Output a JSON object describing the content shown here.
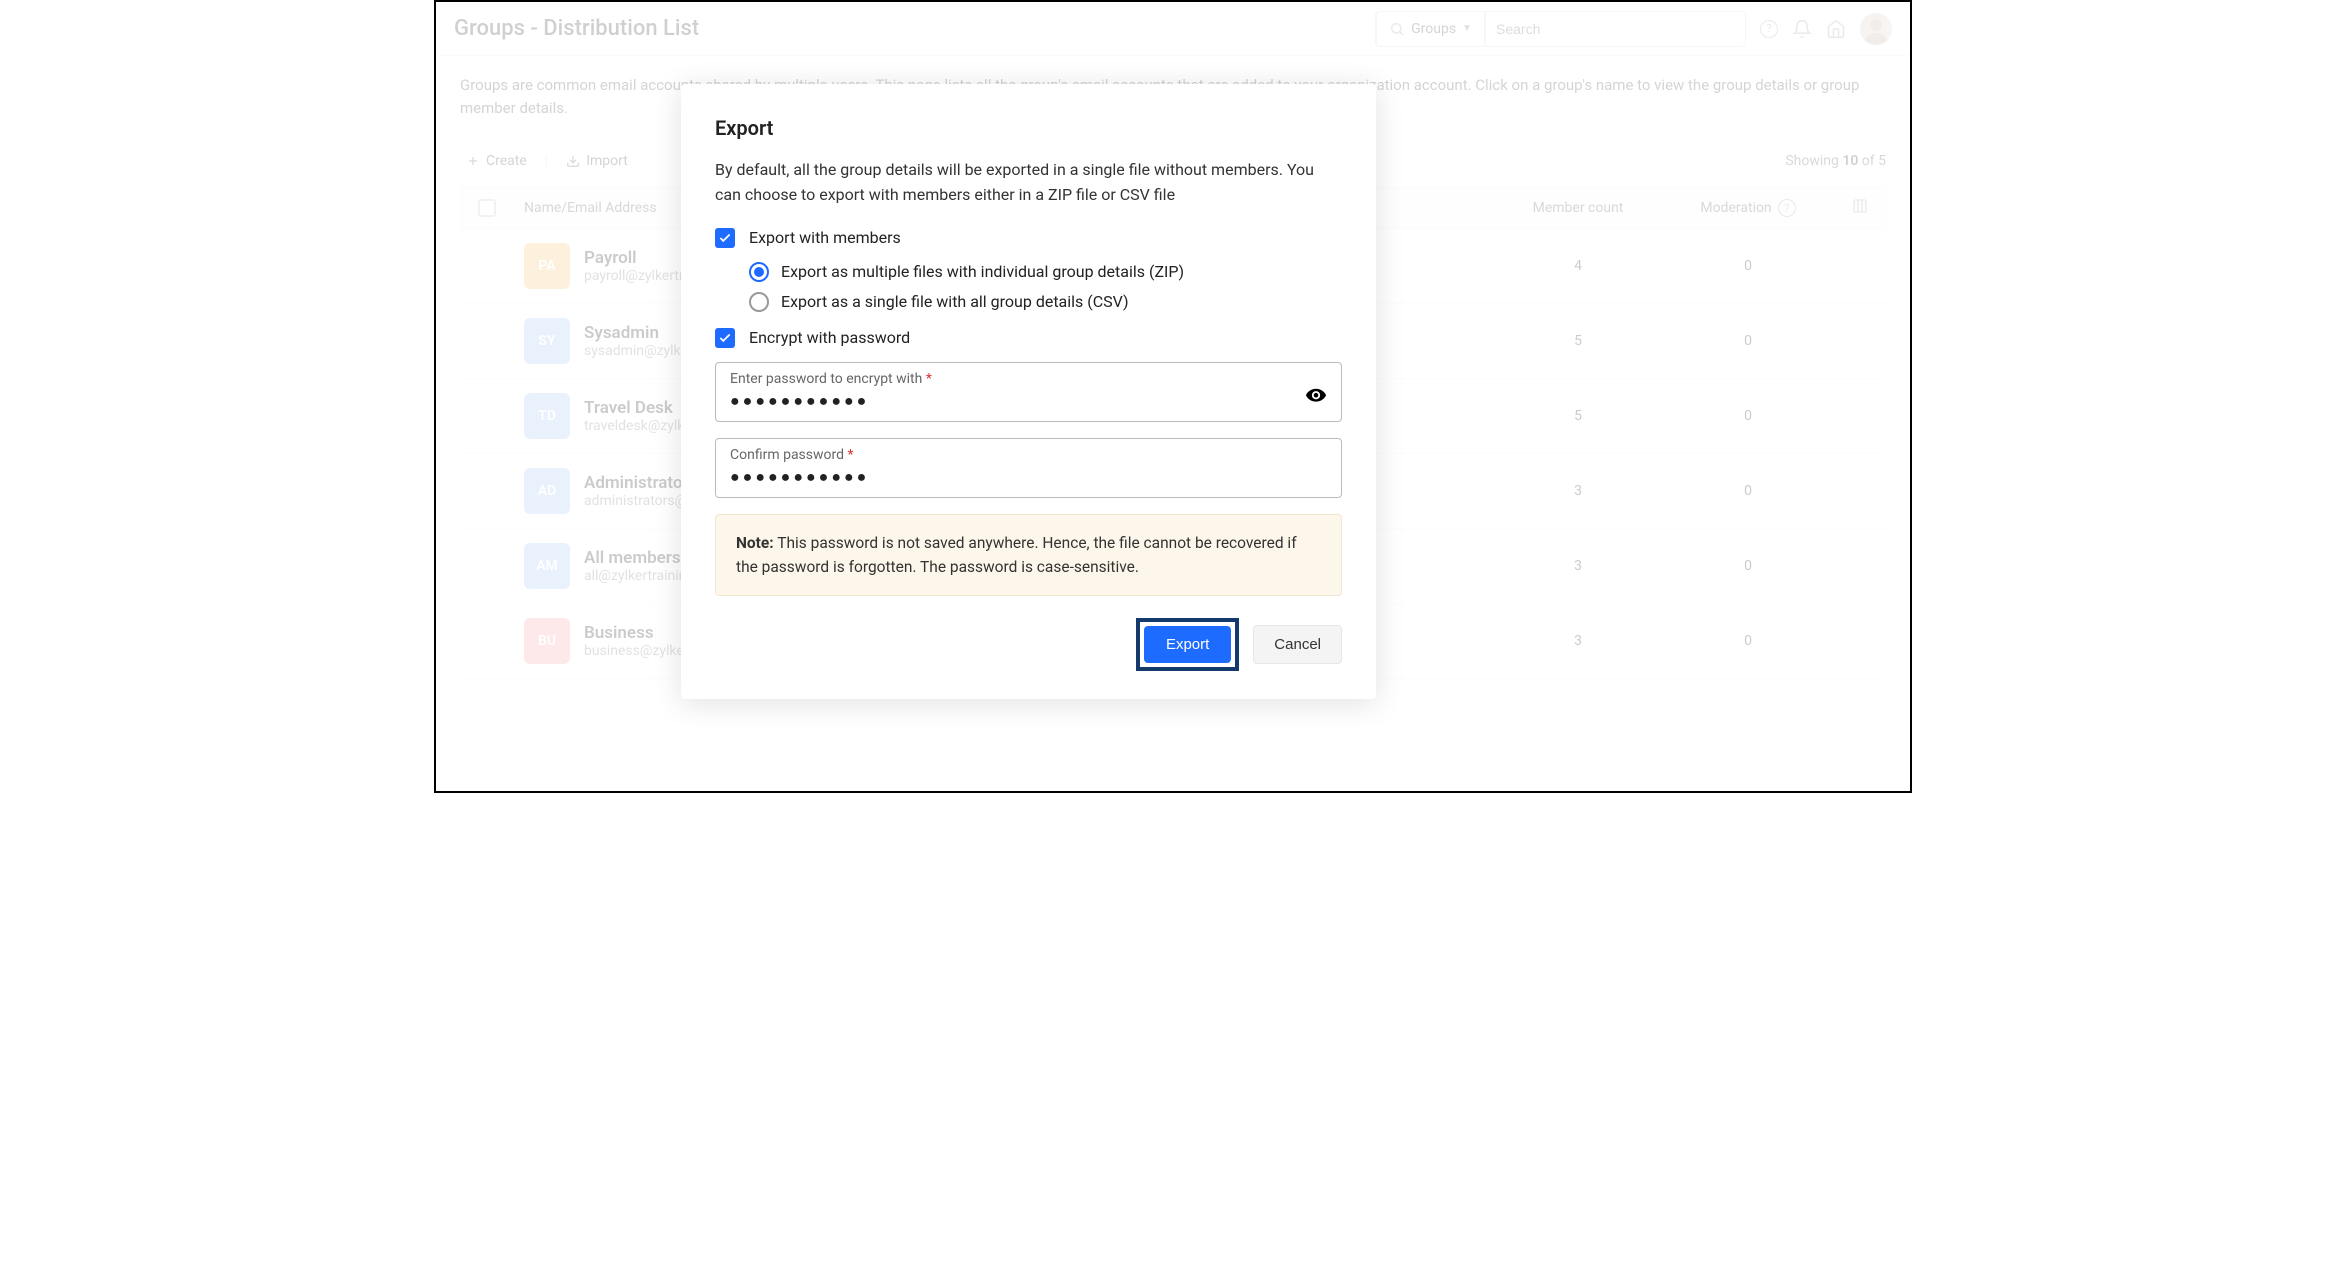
{
  "header": {
    "title": "Groups - Distribution List",
    "scope_label": "Groups",
    "search_placeholder": "Search"
  },
  "description": "Groups are common email accounts shared by multiple users. This page lists all the group's email accounts that are added to your organization account. Click on a group's name to view the group details or group member details.",
  "toolbar": {
    "create": "Create",
    "import": "Import",
    "showing_prefix": "Showing ",
    "showing_count": "10",
    "showing_mid": " of ",
    "showing_total": "5"
  },
  "columns": {
    "name": "Name/Email Address",
    "count": "Member count",
    "moderation": "Moderation"
  },
  "rows": [
    {
      "badge": "PA",
      "color": "orange",
      "name": "Payroll",
      "email": "payroll@zylkertraining.com",
      "count": "4",
      "moderation": "0"
    },
    {
      "badge": "SY",
      "color": "blue",
      "name": "Sysadmin",
      "email": "sysadmin@zylkertraining.com",
      "count": "5",
      "moderation": "0"
    },
    {
      "badge": "TD",
      "color": "blue",
      "name": "Travel Desk",
      "email": "traveldesk@zylkertraining.com",
      "count": "5",
      "moderation": "0"
    },
    {
      "badge": "AD",
      "color": "blue",
      "name": "Administrators",
      "email": "administrators@zylkertraining.com",
      "count": "3",
      "moderation": "0"
    },
    {
      "badge": "AM",
      "color": "blue",
      "name": "All members",
      "email": "all@zylkertraining.com",
      "count": "3",
      "moderation": "0"
    },
    {
      "badge": "BU",
      "color": "red",
      "name": "Business",
      "email": "business@zylkertraining.com",
      "count": "3",
      "moderation": "0"
    }
  ],
  "modal": {
    "title": "Export",
    "description": "By default, all the group details will be exported in a single file without members. You can choose to export with members either in a ZIP file or CSV file",
    "export_members_label": "Export with members",
    "radio_zip": "Export as multiple files with individual group details (ZIP)",
    "radio_csv": "Export as a single file with all group details (CSV)",
    "encrypt_label": "Encrypt with password",
    "password_label": "Enter password to encrypt with",
    "password_dots": "●●●●●●●●●●●",
    "confirm_label": "Confirm password",
    "confirm_dots": "●●●●●●●●●●●",
    "note_prefix": "Note:",
    "note_text": " This password is not saved anywhere. Hence, the file cannot be recovered if the password is forgotten. The password is case-sensitive.",
    "export_btn": "Export",
    "cancel_btn": "Cancel"
  }
}
